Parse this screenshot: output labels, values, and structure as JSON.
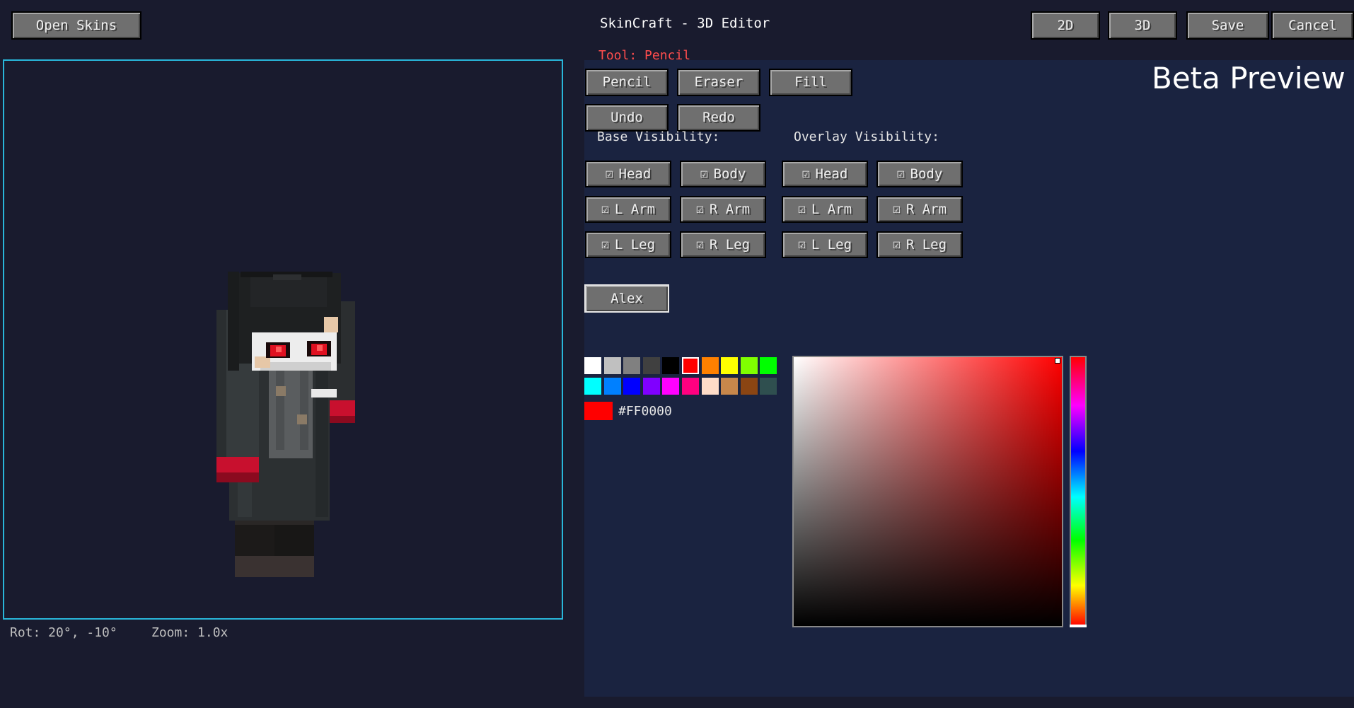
{
  "header": {
    "title": "SkinCraft - 3D Editor",
    "open_skins": "Open Skins",
    "btn_2d": "2D",
    "btn_3d": "3D",
    "save": "Save",
    "cancel": "Cancel"
  },
  "tool_status": "Tool: Pencil",
  "beta_label": "Beta Preview",
  "tools": {
    "pencil": "Pencil",
    "eraser": "Eraser",
    "fill": "Fill",
    "undo": "Undo",
    "redo": "Redo"
  },
  "base_visibility": {
    "label": "Base Visibility:",
    "parts": [
      "Head",
      "Body",
      "L Arm",
      "R Arm",
      "L Leg",
      "R Leg"
    ]
  },
  "overlay_visibility": {
    "label": "Overlay Visibility:",
    "parts": [
      "Head",
      "Body",
      "L Arm",
      "R Arm",
      "L Leg",
      "R Leg"
    ]
  },
  "checkbox_glyph": "☑",
  "model_button": "Alex",
  "palette": {
    "row1": [
      "#ffffff",
      "#c0c0c0",
      "#808080",
      "#404040",
      "#000000",
      "#ff0000",
      "#ff8000",
      "#ffff00",
      "#80ff00",
      "#00ff00"
    ],
    "row2": [
      "#00ffff",
      "#0080ff",
      "#0000ff",
      "#8000ff",
      "#ff00ff",
      "#ff0080",
      "#ffdcc8",
      "#c8874b",
      "#8b4513",
      "#2f4f4f"
    ],
    "selected": "#ff0000"
  },
  "current_color": {
    "hex": "#FF0000",
    "value": "#ff0000"
  },
  "viewport_status": {
    "rotation": "Rot: 20°, -10°",
    "zoom": "Zoom: 1.0x"
  },
  "colors": {
    "viewport_border": "#29b6d9",
    "tool_status": "#ff4d4d",
    "panel_bg": "#1a2340",
    "app_bg": "#191b2e"
  }
}
